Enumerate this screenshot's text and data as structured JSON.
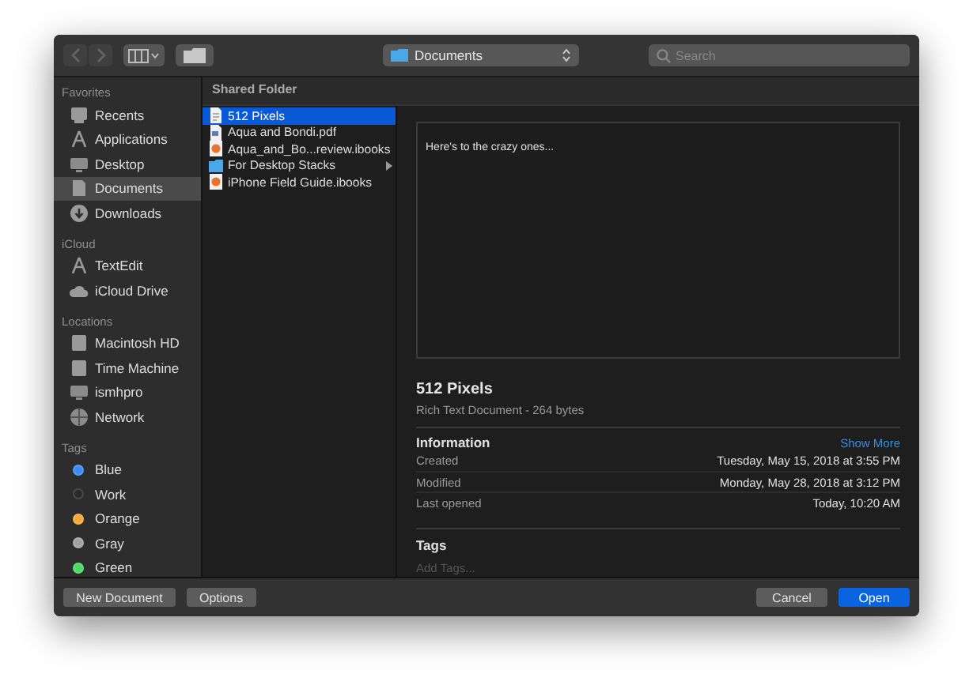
{
  "toolbar": {
    "location": "Documents",
    "search": {
      "placeholder": "Search"
    }
  },
  "sidebar": [
    {
      "heading": "Favorites",
      "items": [
        {
          "label": "Recents",
          "selected": false
        },
        {
          "label": "Applications",
          "selected": false
        },
        {
          "label": "Desktop",
          "selected": false
        },
        {
          "label": "Documents",
          "selected": true
        },
        {
          "label": "Downloads",
          "selected": false
        }
      ]
    },
    {
      "heading": "iCloud",
      "items": [
        {
          "label": "TextEdit",
          "selected": false
        },
        {
          "label": "iCloud Drive",
          "selected": false
        }
      ]
    },
    {
      "heading": "Locations",
      "items": [
        {
          "label": "Macintosh HD",
          "selected": false
        },
        {
          "label": "Time Machine",
          "selected": false
        },
        {
          "label": "ismhpro",
          "selected": false
        },
        {
          "label": "Network",
          "selected": false
        }
      ]
    },
    {
      "heading": "Tags",
      "items": [
        {
          "label": "Blue",
          "selected": false,
          "color": "#3b8cf5"
        },
        {
          "label": "Work",
          "selected": false,
          "color": "#2a2a2c"
        },
        {
          "label": "Orange",
          "selected": false,
          "color": "#f7a93a"
        },
        {
          "label": "Gray",
          "selected": false,
          "color": "#a3a3a3"
        },
        {
          "label": "Green",
          "selected": false,
          "color": "#4cd964"
        }
      ]
    }
  ],
  "path_header": "Shared Folder",
  "files": [
    {
      "name": "512 Pixels",
      "kind": "document",
      "selected": true
    },
    {
      "name": "Aqua and Bondi.pdf",
      "kind": "pdf",
      "selected": false
    },
    {
      "name": "Aqua_and_Bo...review.ibooks",
      "kind": "book",
      "selected": false
    },
    {
      "name": "For Desktop Stacks",
      "kind": "folder",
      "selected": false
    },
    {
      "name": "iPhone Field Guide.ibooks",
      "kind": "book",
      "selected": false
    }
  ],
  "preview": {
    "text": "Here's to the crazy ones...",
    "name": "512 Pixels",
    "subtitle": "Rich Text Document - 264 bytes",
    "info_heading": "Information",
    "show_more": "Show More",
    "info": [
      {
        "label": "Created",
        "value": "Tuesday, May 15, 2018 at 3:55 PM"
      },
      {
        "label": "Modified",
        "value": "Monday, May 28, 2018 at 3:12 PM"
      },
      {
        "label": "Last opened",
        "value": "Today, 10:20 AM"
      }
    ],
    "tags_heading": "Tags",
    "tags_placeholder": "Add Tags..."
  },
  "buttons_left": [
    "New Document",
    "Options"
  ],
  "buttons_right": [
    {
      "label": "Cancel",
      "default": false
    },
    {
      "label": "Open",
      "default": true
    }
  ]
}
